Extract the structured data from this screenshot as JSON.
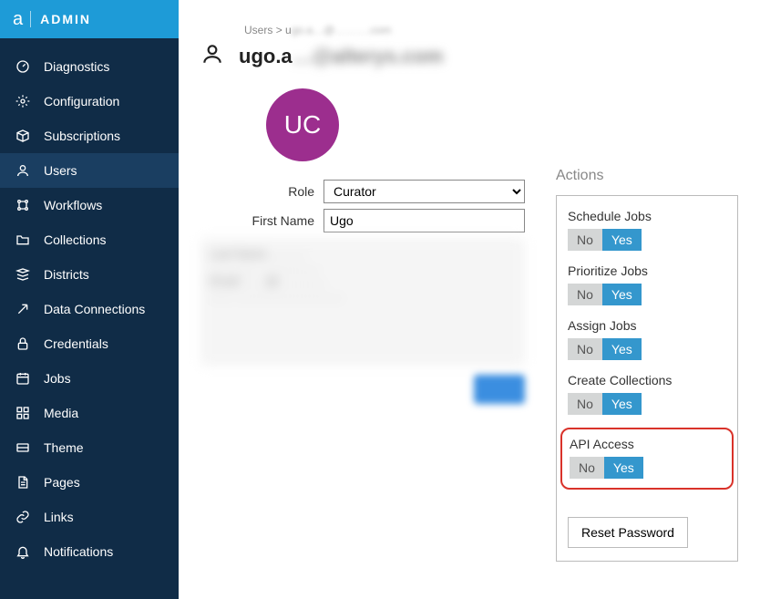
{
  "header": {
    "logo": "a",
    "title": "ADMIN"
  },
  "sidebar": {
    "items": [
      {
        "label": "Diagnostics",
        "icon": "dashboard-icon"
      },
      {
        "label": "Configuration",
        "icon": "gear-icon"
      },
      {
        "label": "Subscriptions",
        "icon": "box-icon"
      },
      {
        "label": "Users",
        "icon": "person-icon",
        "active": true
      },
      {
        "label": "Workflows",
        "icon": "workflow-icon"
      },
      {
        "label": "Collections",
        "icon": "folder-icon"
      },
      {
        "label": "Districts",
        "icon": "stack-icon"
      },
      {
        "label": "Data Connections",
        "icon": "arrow-icon"
      },
      {
        "label": "Credentials",
        "icon": "lock-icon"
      },
      {
        "label": "Jobs",
        "icon": "calendar-icon"
      },
      {
        "label": "Media",
        "icon": "grid-icon"
      },
      {
        "label": "Theme",
        "icon": "theme-icon"
      },
      {
        "label": "Pages",
        "icon": "document-icon"
      },
      {
        "label": "Links",
        "icon": "link-icon"
      },
      {
        "label": "Notifications",
        "icon": "bell-icon"
      }
    ]
  },
  "breadcrumb": {
    "root": "Users",
    "sep": ">",
    "leaf_visible": "u",
    "leaf_blurred": "go.a…@……….com"
  },
  "page": {
    "title_visible": "ugo.a",
    "title_blurred": "…@alterys.com"
  },
  "avatar": {
    "initials": "UC",
    "bg": "#9c2e8e"
  },
  "form": {
    "role_label": "Role",
    "role_value": "Curator",
    "role_options": [
      "Curator"
    ],
    "firstname_label": "First Name",
    "firstname_value": "Ugo"
  },
  "actions": {
    "title": "Actions",
    "items": [
      {
        "label": "Schedule Jobs",
        "no": "No",
        "yes": "Yes",
        "value": "yes"
      },
      {
        "label": "Prioritize Jobs",
        "no": "No",
        "yes": "Yes",
        "value": "yes"
      },
      {
        "label": "Assign Jobs",
        "no": "No",
        "yes": "Yes",
        "value": "yes"
      },
      {
        "label": "Create Collections",
        "no": "No",
        "yes": "Yes",
        "value": "yes"
      },
      {
        "label": "API Access",
        "no": "No",
        "yes": "Yes",
        "value": "yes",
        "highlighted": true
      }
    ],
    "reset_label": "Reset Password"
  }
}
